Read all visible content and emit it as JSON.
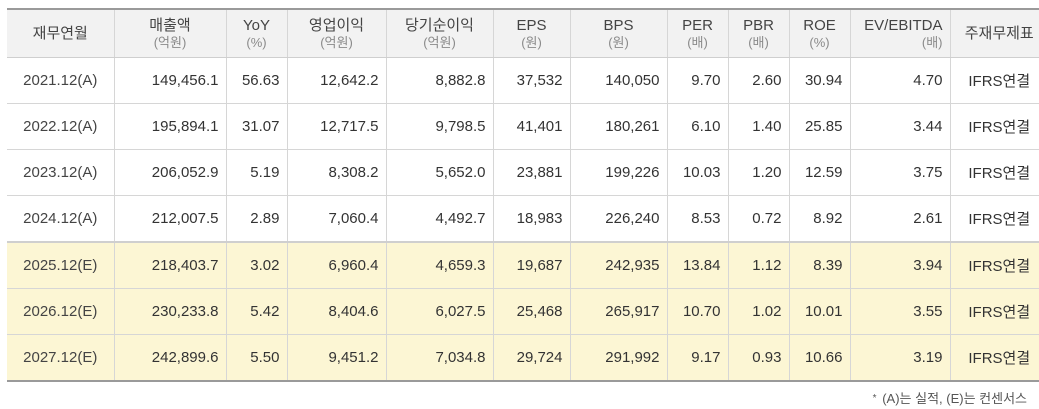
{
  "headers": [
    {
      "key": "period",
      "label": "재무연월",
      "unit": ""
    },
    {
      "key": "sales",
      "label": "매출액",
      "unit": "(억원)"
    },
    {
      "key": "yoy",
      "label": "YoY",
      "unit": "(%)"
    },
    {
      "key": "op_income",
      "label": "영업이익",
      "unit": "(억원)"
    },
    {
      "key": "net_income",
      "label": "당기순이익",
      "unit": "(억원)"
    },
    {
      "key": "eps",
      "label": "EPS",
      "unit": "(원)"
    },
    {
      "key": "bps",
      "label": "BPS",
      "unit": "(원)"
    },
    {
      "key": "per",
      "label": "PER",
      "unit": "(배)"
    },
    {
      "key": "pbr",
      "label": "PBR",
      "unit": "(배)"
    },
    {
      "key": "roe",
      "label": "ROE",
      "unit": "(%)"
    },
    {
      "key": "ev_ebitda",
      "label": "EV/EBITDA",
      "unit": "(배)"
    },
    {
      "key": "basis",
      "label": "주재무제표",
      "unit": ""
    }
  ],
  "rows": [
    {
      "period": "2021.12(A)",
      "sales": "149,456.1",
      "yoy": "56.63",
      "op_income": "12,642.2",
      "net_income": "8,882.8",
      "eps": "37,532",
      "bps": "140,050",
      "per": "9.70",
      "pbr": "2.60",
      "roe": "30.94",
      "ev_ebitda": "4.70",
      "basis": "IFRS연결"
    },
    {
      "period": "2022.12(A)",
      "sales": "195,894.1",
      "yoy": "31.07",
      "op_income": "12,717.5",
      "net_income": "9,798.5",
      "eps": "41,401",
      "bps": "180,261",
      "per": "6.10",
      "pbr": "1.40",
      "roe": "25.85",
      "ev_ebitda": "3.44",
      "basis": "IFRS연결"
    },
    {
      "period": "2023.12(A)",
      "sales": "206,052.9",
      "yoy": "5.19",
      "op_income": "8,308.2",
      "net_income": "5,652.0",
      "eps": "23,881",
      "bps": "199,226",
      "per": "10.03",
      "pbr": "1.20",
      "roe": "12.59",
      "ev_ebitda": "3.75",
      "basis": "IFRS연결"
    },
    {
      "period": "2024.12(A)",
      "sales": "212,007.5",
      "yoy": "2.89",
      "op_income": "7,060.4",
      "net_income": "4,492.7",
      "eps": "18,983",
      "bps": "226,240",
      "per": "8.53",
      "pbr": "0.72",
      "roe": "8.92",
      "ev_ebitda": "2.61",
      "basis": "IFRS연결"
    },
    {
      "period": "2025.12(E)",
      "sales": "218,403.7",
      "yoy": "3.02",
      "op_income": "6,960.4",
      "net_income": "4,659.3",
      "eps": "19,687",
      "bps": "242,935",
      "per": "13.84",
      "pbr": "1.12",
      "roe": "8.39",
      "ev_ebitda": "3.94",
      "basis": "IFRS연결"
    },
    {
      "period": "2026.12(E)",
      "sales": "230,233.8",
      "yoy": "5.42",
      "op_income": "8,404.6",
      "net_income": "6,027.5",
      "eps": "25,468",
      "bps": "265,917",
      "per": "10.70",
      "pbr": "1.02",
      "roe": "10.01",
      "ev_ebitda": "3.55",
      "basis": "IFRS연결"
    },
    {
      "period": "2027.12(E)",
      "sales": "242,899.6",
      "yoy": "5.50",
      "op_income": "9,451.2",
      "net_income": "7,034.8",
      "eps": "29,724",
      "bps": "291,992",
      "per": "9.17",
      "pbr": "0.93",
      "roe": "10.66",
      "ev_ebitda": "3.19",
      "basis": "IFRS연결"
    }
  ],
  "footnote": {
    "marker": "*",
    "text": "(A)는 실적, (E)는 컨센서스"
  },
  "colors": {
    "header_bg": "#f2f2f2",
    "estimate_bg": "#fcf6d4",
    "border": "#d6d6d6"
  }
}
